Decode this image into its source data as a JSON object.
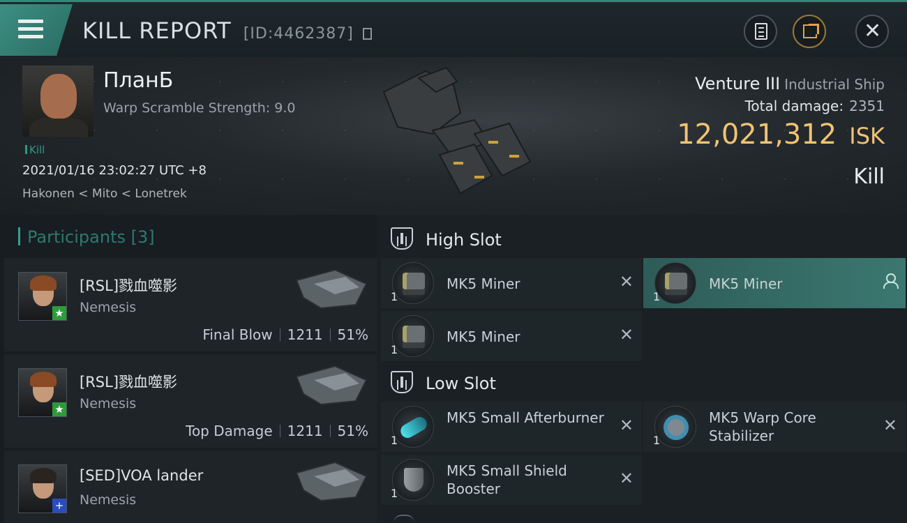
{
  "header": {
    "title": "KILL REPORT",
    "report_id": "[ID:4462387]"
  },
  "victim": {
    "name": "ПланБ",
    "warp_scramble": "Warp Scramble Strength: 9.0",
    "tag": "Kill",
    "time": "2021/01/16 23:02:27 UTC +8",
    "location": "Hakonen < Mito < Lonetrek"
  },
  "ship": {
    "name": "Venture III",
    "type": "Industrial Ship",
    "damage_label": "Total damage:",
    "damage_value": "2351",
    "isk_value": "12,021,312",
    "isk_unit": "ISK",
    "result": "Kill"
  },
  "participants": {
    "title": "Participants [3]",
    "items": [
      {
        "name": "[RSL]戮血噬影",
        "corp": "Nemesis",
        "role": "Final Blow",
        "damage": "1211",
        "percent": "51%",
        "badge": "★"
      },
      {
        "name": "[RSL]戮血噬影",
        "corp": "Nemesis",
        "role": "Top Damage",
        "damage": "1211",
        "percent": "51%",
        "badge": "★"
      },
      {
        "name": "[SED]VOA lander",
        "corp": "Nemesis",
        "role": "",
        "damage": "",
        "percent": "",
        "badge": "+"
      }
    ]
  },
  "fitting": {
    "high_slot_title": "High Slot",
    "low_slot_title": "Low Slot",
    "high": [
      {
        "name": "MK5 Miner",
        "qty": "1"
      },
      {
        "name": "MK5 Miner",
        "qty": "1"
      },
      {
        "name": "MK5 Miner",
        "qty": "1"
      }
    ],
    "low": [
      {
        "name": "MK5 Small Afterburner",
        "qty": "1"
      },
      {
        "name": "MK5 Warp Core Stabilizer",
        "qty": "1"
      },
      {
        "name": "MK5 Small Shield Booster",
        "qty": "1"
      }
    ]
  }
}
